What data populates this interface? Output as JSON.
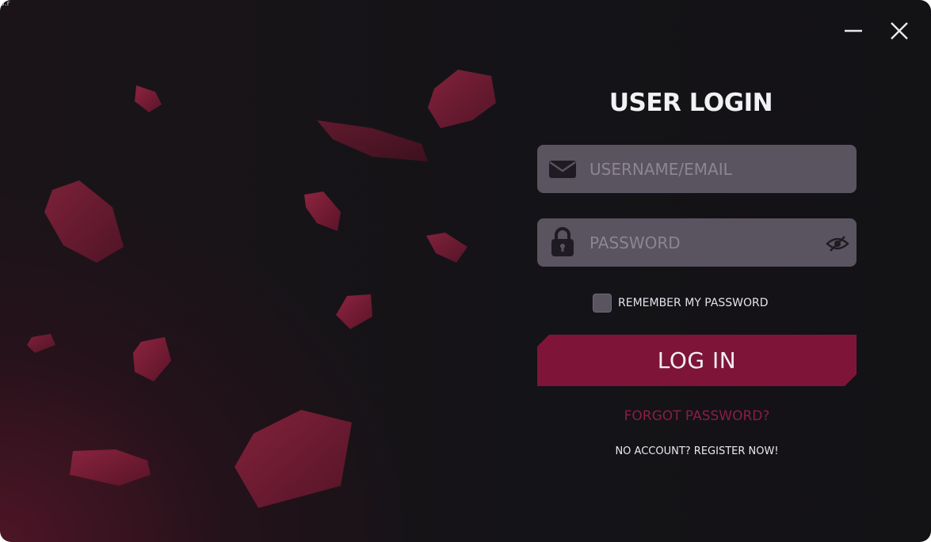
{
  "window": {
    "corner_text": "3.r"
  },
  "title_bar": {
    "minimize_icon": "minimize-icon",
    "close_icon": "close-icon"
  },
  "login": {
    "title": "USER LOGIN",
    "username": {
      "placeholder": "USERNAME/EMAIL",
      "value": "",
      "icon": "mail-icon"
    },
    "password": {
      "placeholder": "PASSWORD",
      "value": "",
      "icon": "lock-icon",
      "toggle_icon": "eye-off-icon"
    },
    "remember": {
      "label": "REMEMBER MY PASSWORD",
      "checked": false
    },
    "login_button_label": "LOG IN",
    "forgot_label": "FORGOT PASSWORD?",
    "register_label": "NO ACCOUNT? REGISTER NOW!"
  },
  "colors": {
    "accent": "#7e1539",
    "accent_text": "#8b1d45",
    "field_bg": "#5a5360",
    "background": "#141317"
  }
}
